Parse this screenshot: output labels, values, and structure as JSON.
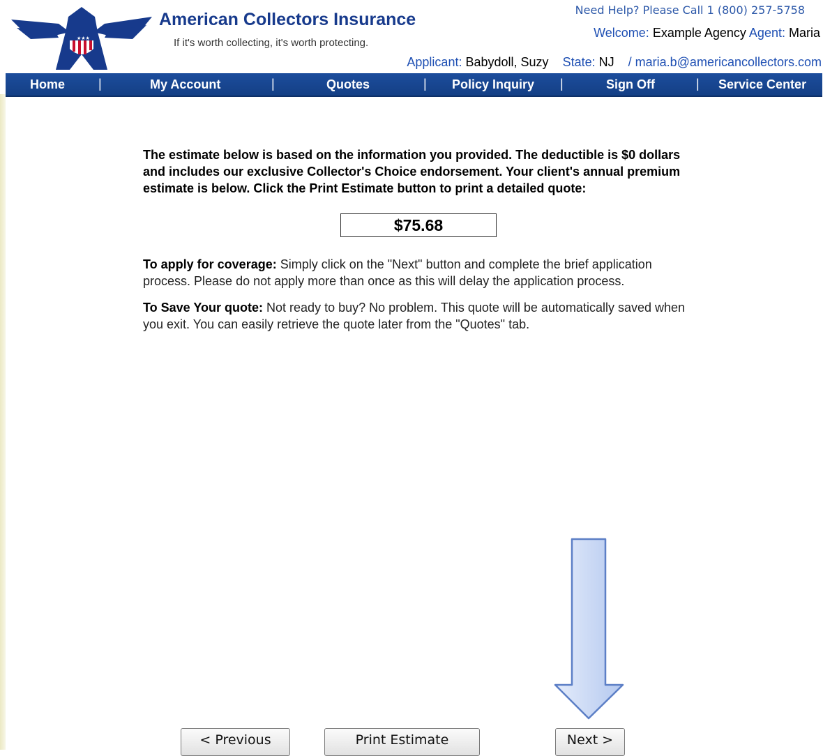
{
  "header": {
    "brand_name": "American Collectors Insurance",
    "tagline": "If it's worth collecting, it's worth protecting.",
    "help_line": "Need Help? Please Call 1 (800) 257-5758",
    "welcome_label": "Welcome:",
    "agency": "Example Agency",
    "agent_label": "Agent:",
    "agent": "Maria",
    "applicant_label": "Applicant:",
    "applicant": "Babydoll, Suzy",
    "state_label": "State:",
    "state": "NJ",
    "email": "/ maria.b@americancollectors.com"
  },
  "nav": {
    "items": [
      "Home",
      "My Account",
      "Quotes",
      "Policy Inquiry",
      "Sign Off",
      "Service Center"
    ],
    "separator": "|"
  },
  "content": {
    "intro": "The estimate below is based on the information you provided. The deductible is $0 dollars and includes our exclusive Collector's Choice endorsement. Your client's annual premium estimate is below. Click the Print Estimate button to print a detailed quote:",
    "premium": "$75.68",
    "apply_label": "To apply for coverage:",
    "apply_text": " Simply click on the \"Next\" button and complete the brief application process. Please do not apply more than once as this will delay the application process.",
    "save_label": "To Save Your quote:",
    "save_text": " Not ready to buy? No problem. This quote will be automatically saved when you exit. You can easily retrieve the quote later from the \"Quotes\" tab."
  },
  "buttons": {
    "previous": "< Previous",
    "print": "Print Estimate",
    "next": "Next >"
  },
  "colors": {
    "brand_blue": "#173a8c",
    "nav_blue": "#1c4d9c",
    "label_blue": "#1e4fb3",
    "arrow_fill": "#c9d8f5"
  }
}
